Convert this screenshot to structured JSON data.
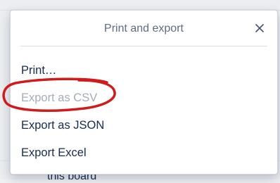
{
  "popover": {
    "title": "Print and export",
    "close_icon": "close-icon"
  },
  "menu": {
    "items": [
      {
        "label": "Print…",
        "enabled": true
      },
      {
        "label": "Export as CSV",
        "enabled": false
      },
      {
        "label": "Export as JSON",
        "enabled": true
      },
      {
        "label": "Export Excel",
        "enabled": true
      }
    ]
  },
  "background": {
    "partial_text": "this board"
  },
  "annotation": {
    "type": "hand-drawn circle",
    "color": "#d11a1a",
    "target": "Export as CSV"
  },
  "colors": {
    "title": "#5e6c84",
    "text": "#172b4d",
    "disabled": "#a5adba",
    "annotation": "#d11a1a"
  }
}
